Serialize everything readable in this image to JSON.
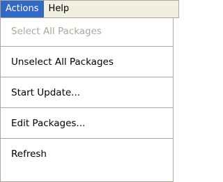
{
  "menubar": {
    "items": [
      {
        "label": "Actions"
      },
      {
        "label": "Help"
      }
    ]
  },
  "actions_menu": {
    "items": [
      {
        "label": "Select All Packages",
        "enabled": false
      },
      {
        "label": "Unselect All Packages",
        "enabled": true
      },
      {
        "label": "Start Update...",
        "enabled": true
      },
      {
        "label": "Edit Packages...",
        "enabled": true
      },
      {
        "label": "Refresh",
        "enabled": true
      }
    ]
  },
  "colors": {
    "menubar_bg": "#f1efe2",
    "highlight_bg": "#316ac5",
    "highlight_text": "#ffffff",
    "disabled_text": "#aca899",
    "separator": "#aca899",
    "menu_bg": "#ffffff"
  }
}
